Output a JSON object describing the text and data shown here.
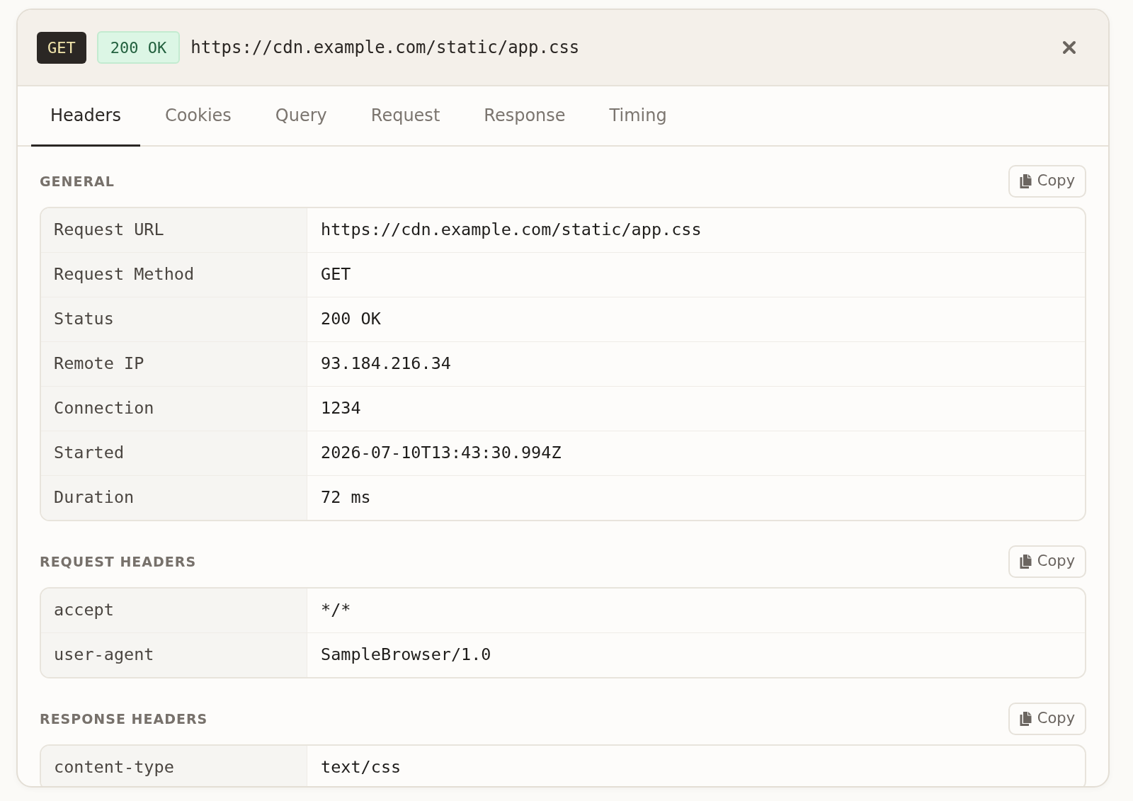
{
  "header": {
    "method": "GET",
    "status": "200 OK",
    "url": "https://cdn.example.com/static/app.css"
  },
  "tabs": [
    {
      "label": "Headers",
      "selected": true
    },
    {
      "label": "Cookies",
      "selected": false
    },
    {
      "label": "Query",
      "selected": false
    },
    {
      "label": "Request",
      "selected": false
    },
    {
      "label": "Response",
      "selected": false
    },
    {
      "label": "Timing",
      "selected": false
    }
  ],
  "sections": [
    {
      "title": "GENERAL",
      "copy_button": "Copy",
      "rows": [
        {
          "name": "Request URL",
          "value": "https://cdn.example.com/static/app.css"
        },
        {
          "name": "Request Method",
          "value": "GET"
        },
        {
          "name": "Status",
          "value": "200 OK"
        },
        {
          "name": "Remote IP",
          "value": "93.184.216.34"
        },
        {
          "name": "Connection",
          "value": "1234"
        },
        {
          "name": "Started",
          "value": "2026-07-10T13:43:30.994Z"
        },
        {
          "name": "Duration",
          "value": "72 ms"
        }
      ]
    },
    {
      "title": "REQUEST HEADERS",
      "copy_button": "Copy",
      "rows": [
        {
          "name": "accept",
          "value": "*/*"
        },
        {
          "name": "user-agent",
          "value": "SampleBrowser/1.0"
        }
      ]
    },
    {
      "title": "RESPONSE HEADERS",
      "copy_button": "Copy",
      "rows": [
        {
          "name": "content-type",
          "value": "text/css"
        }
      ]
    }
  ]
}
